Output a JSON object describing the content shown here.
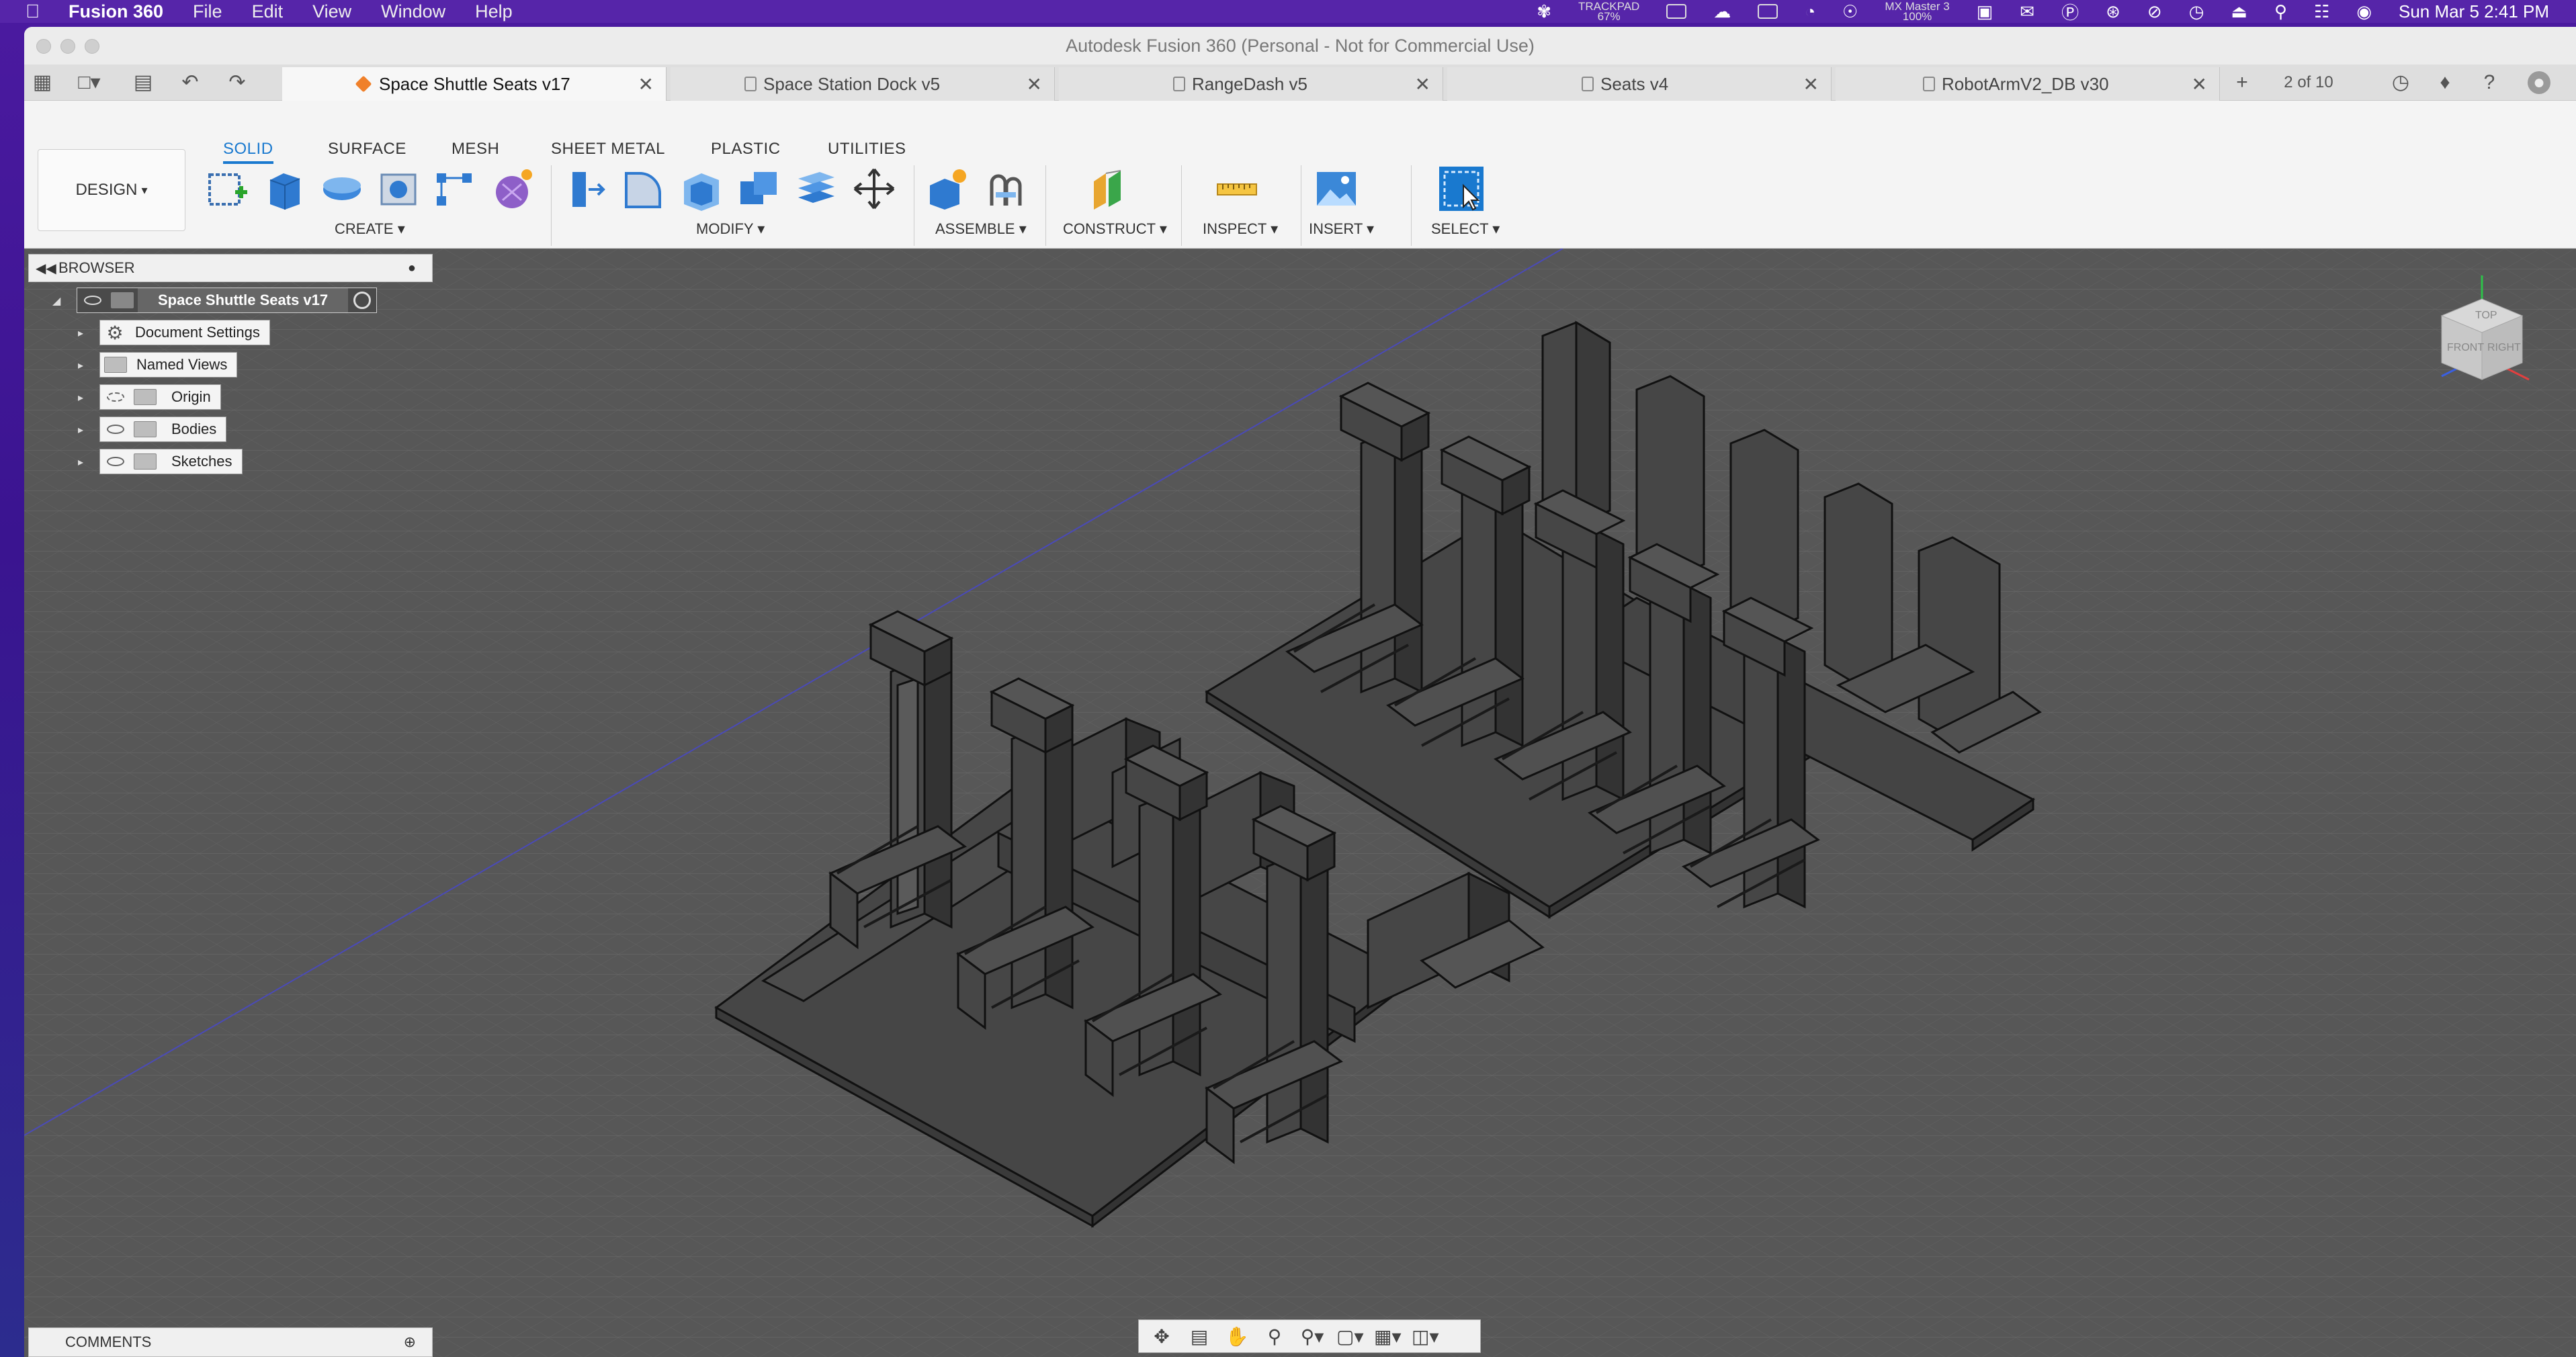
{
  "menubar": {
    "app_name": "Fusion 360",
    "items": [
      "File",
      "Edit",
      "View",
      "Window",
      "Help"
    ],
    "trackpad_label": "TRACKPAD",
    "trackpad_value": "67%",
    "mouse_label": "MX Master 3",
    "mouse_value": "100%",
    "datetime": "Sun Mar 5  2:41 PM"
  },
  "window": {
    "title": "Autodesk Fusion 360 (Personal - Not for Commercial Use)"
  },
  "tabs": [
    {
      "label": "Space Shuttle Seats v17",
      "active": true
    },
    {
      "label": "Space Station Dock v5",
      "active": false
    },
    {
      "label": "RangeDash v5",
      "active": false
    },
    {
      "label": "Seats v4",
      "active": false
    },
    {
      "label": "RobotArmV2_DB v30",
      "active": false
    }
  ],
  "tab_counter": "2 of 10",
  "toolbar": {
    "workspace": "DESIGN",
    "workspace_tabs": [
      "SOLID",
      "SURFACE",
      "MESH",
      "SHEET METAL",
      "PLASTIC",
      "UTILITIES"
    ],
    "groups": [
      "CREATE",
      "MODIFY",
      "ASSEMBLE",
      "CONSTRUCT",
      "INSPECT",
      "INSERT",
      "SELECT"
    ]
  },
  "browser": {
    "title": "BROWSER",
    "root": "Space Shuttle Seats v17",
    "items": [
      "Document Settings",
      "Named Views",
      "Origin",
      "Bodies",
      "Sketches"
    ]
  },
  "comments": {
    "title": "COMMENTS"
  },
  "viewcube": {
    "top_label": "TOP",
    "front_label": "FRONT",
    "right_label": "RIGHT"
  },
  "colors": {
    "accent": "#1979cf",
    "viewport_bg": "#5a5a5a",
    "model": "#454545"
  }
}
